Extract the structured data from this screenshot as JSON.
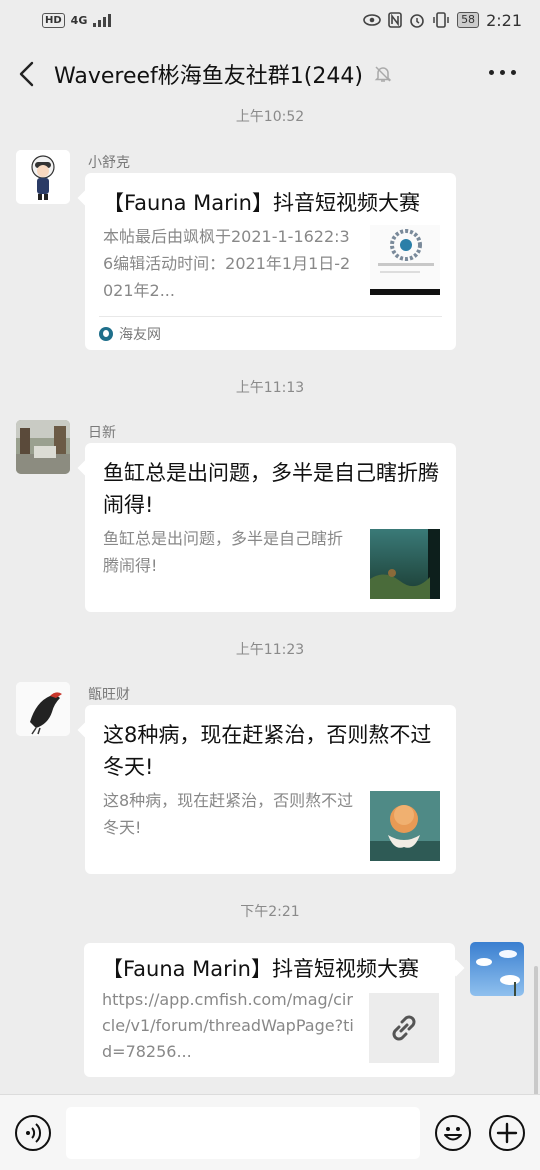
{
  "status_bar": {
    "left_label": "HD",
    "network": "4G",
    "battery": "58",
    "time": "2:21"
  },
  "header": {
    "title": "Wavereef彬海鱼友社群1(244)"
  },
  "messages": [
    {
      "timestamp": "上午10:52",
      "sender": "小舒克",
      "card_title": "【Fauna Marin】抖音短视频大赛",
      "card_desc": "本帖最后由飒枫于2021-1-1622:36编辑活动时间：2021年1月1日-2021年2...",
      "source": "海友网"
    },
    {
      "timestamp": "上午11:13",
      "sender": "日新",
      "card_title": "鱼缸总是出问题，多半是自己瞎折腾闹得!",
      "card_desc": "鱼缸总是出问题，多半是自己瞎折腾闹得!"
    },
    {
      "timestamp": "上午11:23",
      "sender": "甑旺财",
      "card_title": "这8种病，现在赶紧治，否则熬不过冬天!",
      "card_desc": "这8种病，现在赶紧治，否则熬不过冬天!"
    },
    {
      "timestamp": "下午2:21",
      "sender": "",
      "card_title": "【Fauna Marin】抖音短视频大赛",
      "card_desc": "https://app.cmfish.com/mag/circle/v1/forum/threadWapPage?tid=78256..."
    }
  ],
  "icons": {
    "back": "chevron-left-icon",
    "mute": "bell-off-icon",
    "more": "more-dots-icon",
    "voice": "voice-icon",
    "emoji": "emoji-icon",
    "plus": "plus-icon",
    "link": "link-icon"
  },
  "colors": {
    "background": "#ededed",
    "bubble": "#ffffff",
    "meta_text": "#888888"
  }
}
